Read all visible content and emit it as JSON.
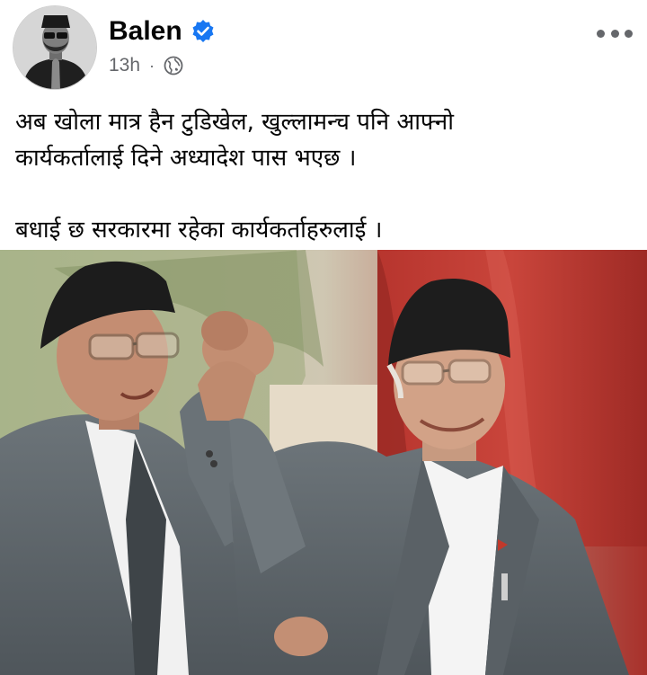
{
  "post": {
    "author_name": "Balen",
    "verified": true,
    "timestamp": "13h",
    "separator": "·",
    "audience_icon": "globe-icon",
    "more_icon": "more-options-icon",
    "text_line1": "अब खोला मात्र हैन टुडिखेल, खुल्लामन्च पनि आफ्नो\nकार्यकर्तालाई दिने अध्यादेश पास भएछ ।",
    "text_line2": "बधाई छ सरकारमा रहेका कार्यकर्ताहरुलाई ।"
  },
  "colors": {
    "verified_blue": "#1877f2",
    "meta_gray": "#65676b",
    "text": "#050505"
  }
}
